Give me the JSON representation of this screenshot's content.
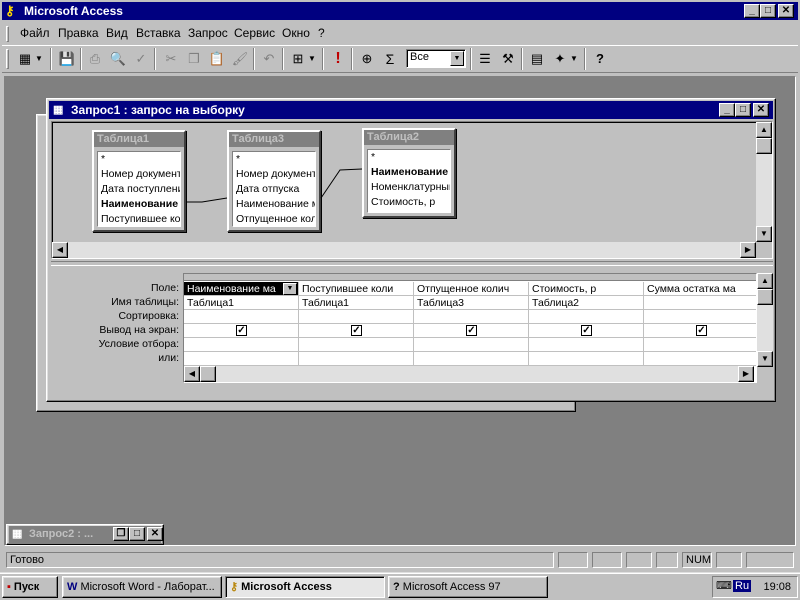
{
  "app": {
    "title": "Microsoft Access",
    "icon": "key-icon"
  },
  "menu": {
    "items": [
      {
        "label": "Файл"
      },
      {
        "label": "Правка"
      },
      {
        "label": "Вид"
      },
      {
        "label": "Вставка"
      },
      {
        "label": "Запрос"
      },
      {
        "label": "Сервис"
      },
      {
        "label": "Окно"
      },
      {
        "label": "?"
      }
    ]
  },
  "toolbar": {
    "top_values_select": "Все",
    "icons": [
      "view-icon",
      "save-icon",
      "print-icon",
      "print-preview-icon",
      "spelling-icon",
      "cut-icon",
      "copy-icon",
      "paste-icon",
      "format-painter-icon",
      "undo-icon",
      "query-type-icon",
      "run-icon",
      "show-table-icon",
      "totals-icon",
      "top-values-select",
      "properties-icon",
      "build-icon",
      "database-window-icon",
      "new-object-icon",
      "help-icon"
    ]
  },
  "query_window": {
    "title": "Запрос1 : запрос на выборку",
    "tables": [
      {
        "name": "Таблица1",
        "fields": [
          "*",
          "Номер документ",
          "Дата поступлени",
          "Наименование м",
          "Поступившее ко"
        ],
        "bold_index": 3
      },
      {
        "name": "Таблица3",
        "fields": [
          "*",
          "Номер документ",
          "Дата отпуска",
          "Наименование м",
          "Отпущенное кол"
        ],
        "bold_index": -1
      },
      {
        "name": "Таблица2",
        "fields": [
          "*",
          "Наименование м",
          "Номенклатурный",
          "Стоимость, р"
        ],
        "bold_index": 1
      }
    ],
    "grid": {
      "row_labels": [
        "Поле:",
        "Имя таблицы:",
        "Сортировка:",
        "Вывод на экран:",
        "Условие отбора:",
        "или:"
      ],
      "columns": [
        {
          "field": "Наименование ма",
          "table": "Таблица1",
          "sort": "",
          "show": true
        },
        {
          "field": "Поступившее коли",
          "table": "Таблица1",
          "sort": "",
          "show": true
        },
        {
          "field": "Отпущенное колич",
          "table": "Таблица3",
          "sort": "",
          "show": true
        },
        {
          "field": "Стоимость, р",
          "table": "Таблица2",
          "sort": "",
          "show": true
        },
        {
          "field": "Сумма остатка ма",
          "table": "",
          "sort": "",
          "show": true
        }
      ]
    }
  },
  "minimized_window": {
    "title": "Запрос2 : ..."
  },
  "statusbar": {
    "text": "Готово",
    "num": "NUM"
  },
  "taskbar": {
    "start": "Пуск",
    "buttons": [
      {
        "label": "Microsoft Word - Лаборат...",
        "icon": "word-icon",
        "active": false
      },
      {
        "label": "Microsoft Access",
        "icon": "key-icon",
        "active": true
      },
      {
        "label": "Microsoft Access 97",
        "icon": "help-doc-icon",
        "active": false
      }
    ],
    "lang": "Ru",
    "clock": "19:08"
  }
}
